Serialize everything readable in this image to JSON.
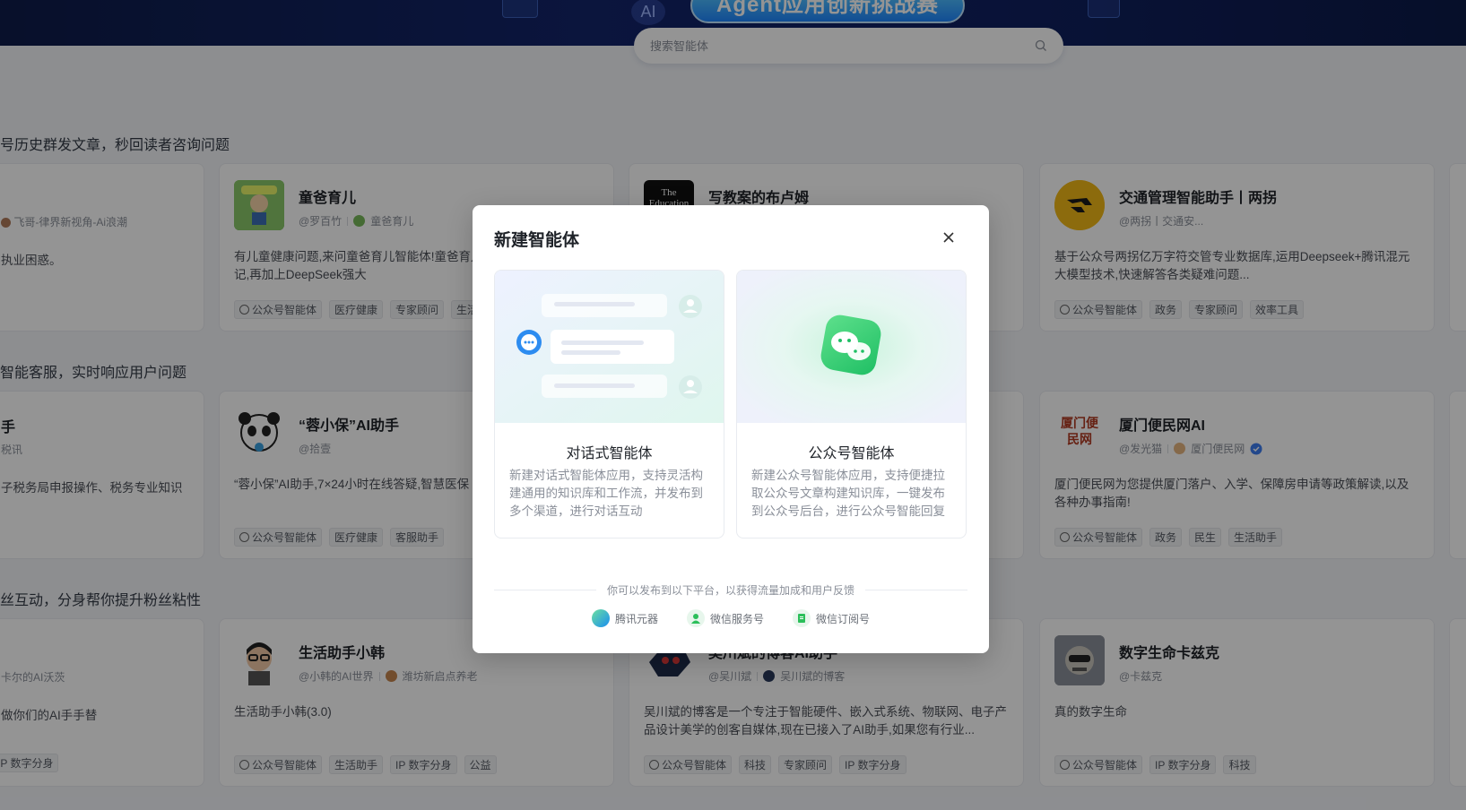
{
  "banner": {
    "ai_label": "AI",
    "pill_text": "Agent应用创新挑战赛"
  },
  "search": {
    "placeholder": "搜索智能体"
  },
  "sections": [
    {
      "title": "号历史群发文章，秒回读者咨询问题"
    },
    {
      "title": "智能客服，实时响应用户问题"
    },
    {
      "title": "丝互动，分身帮你提升粉丝粘性"
    }
  ],
  "left_cards": [
    {
      "author": "飞哥-律界新视角-Ai浪潮",
      "desc": "执业困惑。"
    },
    {
      "name": "手",
      "author": "税讯",
      "desc": "子税务局申报操作、税务专业知识"
    },
    {
      "author": "卡尔的AI沃茨",
      "desc": "做你们的AI手手替"
    }
  ],
  "cards": [
    {
      "name": "童爸育儿",
      "author": "@罗百竹",
      "org": "童爸育儿",
      "desc": "有儿童健康问题,来问童爸育儿智能体!童爸育儿公众号上千篇科普笔记,再加上DeepSeek强大",
      "tags": [
        "公众号智能体",
        "医疗健康",
        "专家顾问",
        "生活"
      ]
    },
    {
      "name": "写教案的布卢姆",
      "avatar_text": "The Education"
    },
    {
      "name": "交通管理智能助手丨两拐",
      "author": "@两拐丨交通安...",
      "desc": "基于公众号两拐亿万字符交管专业数据库,运用Deepseek+腾讯混元大模型技术,快速解答各类疑难问题...",
      "tags": [
        "公众号智能体",
        "政务",
        "专家顾问",
        "效率工具"
      ]
    },
    {
      "name": "“蓉小保”AI助手",
      "author": "@拾壹",
      "desc": "“蓉小保”AI助手,7×24小时在线答疑,智慧医保",
      "tags": [
        "公众号智能体",
        "医疗健康",
        "客服助手"
      ]
    },
    {
      "name": "厦门便民网AI",
      "author": "@发光猫",
      "org": "厦门便民网",
      "avatar_text": "厦门便民网",
      "desc": "厦门便民网为您提供厦门落户、入学、保障房申请等政策解读,以及各种办事指南!",
      "tags": [
        "公众号智能体",
        "政务",
        "民生",
        "生活助手"
      ]
    },
    {
      "name": "生活助手小韩",
      "author": "@小韩的AI世界",
      "org": "潍坊新启点养老",
      "desc": "生活助手小韩(3.0)",
      "tags": [
        "公众号智能体",
        "生活助手",
        "IP 数字分身",
        "公益"
      ]
    },
    {
      "name": "吴川斌的博客AI助手",
      "author": "@吴川斌",
      "org": "吴川斌的博客",
      "desc": "吴川斌的博客是一个专注于智能硬件、嵌入式系统、物联网、电子产品设计美学的创客自媒体,现在已接入了AI助手,如果您有行业...",
      "tags": [
        "公众号智能体",
        "科技",
        "专家顾问",
        "IP 数字分身"
      ]
    },
    {
      "name": "数字生命卡兹克",
      "author": "@卡兹克",
      "desc": "真的数字生命",
      "tags": [
        "公众号智能体",
        "IP 数字分身",
        "科技"
      ]
    }
  ],
  "modal": {
    "title": "新建智能体",
    "options": [
      {
        "title": "对话式智能体",
        "desc": "新建对话式智能体应用，支持灵活构建通用的知识库和工作流，并发布到多个渠道，进行对话互动"
      },
      {
        "title": "公众号智能体",
        "desc": "新建公众号智能体应用，支持便捷拉取公众号文章构建知识库，一键发布到公众号后台，进行公众号智能回复"
      }
    ],
    "platform_hint": "你可以发布到以下平台，以获得流量加成和用户反馈",
    "platforms": [
      {
        "label": "腾讯元器",
        "color": "#1aad6e"
      },
      {
        "label": "微信服务号",
        "color": "#2bbf5a"
      },
      {
        "label": "微信订阅号",
        "color": "#2bbf5a"
      }
    ]
  },
  "left_tags": [
    "IP 数字分身"
  ]
}
